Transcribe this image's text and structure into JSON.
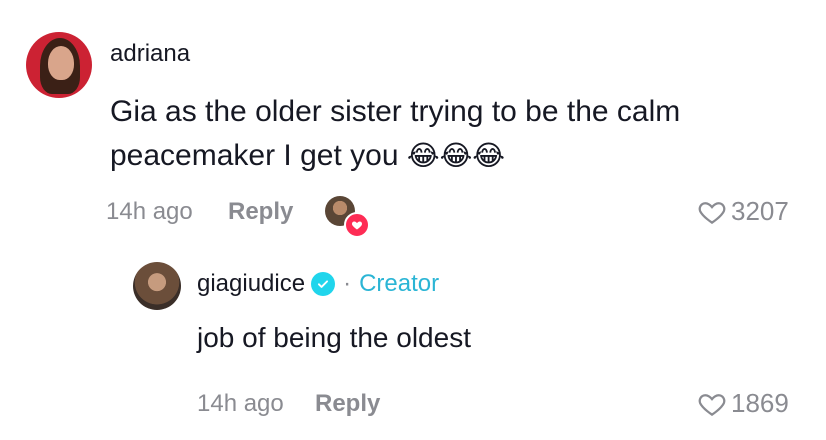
{
  "comment": {
    "username": "adriana",
    "text": "Gia as the older sister trying to be the calm peacemaker I get you",
    "emoji": "😂😂😂",
    "time": "14h ago",
    "reply_label": "Reply",
    "likes": "3207",
    "liked_by_creator": true
  },
  "reply": {
    "username": "giagiudice",
    "verified": true,
    "separator": "·",
    "badge": "Creator",
    "text": "job of being the oldest",
    "time": "14h ago",
    "reply_label": "Reply",
    "likes": "1869"
  },
  "colors": {
    "text_primary": "#161823",
    "text_secondary": "#8a8b91",
    "creator": "#2bb5d5",
    "verified": "#20d5ec",
    "like_badge": "#fe2c55"
  }
}
